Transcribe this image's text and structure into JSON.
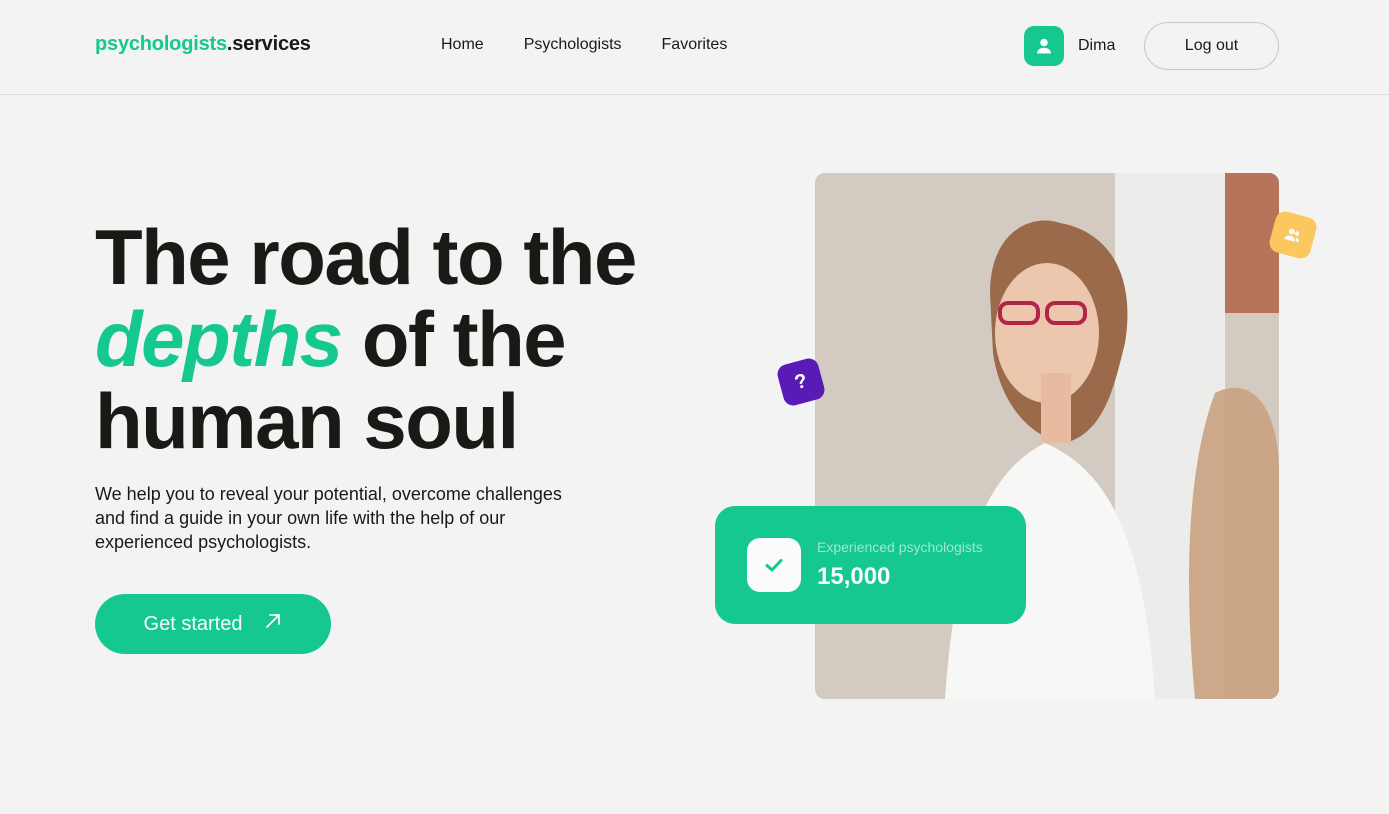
{
  "header": {
    "logo_accent": "psychologists",
    "logo_rest": ".services",
    "nav": [
      "Home",
      "Psychologists",
      "Favorites"
    ],
    "user_name": "Dima",
    "logout_label": "Log out"
  },
  "hero": {
    "title_line1": "The road to the",
    "title_accent": "depths",
    "title_line2_rest": " of the",
    "title_line3": "human soul",
    "description": "We help you to reveal your potential, overcome challenges and find a guide in your own life with the help of our experienced psychologists.",
    "cta_label": "Get started"
  },
  "stat": {
    "label": "Experienced psychologists",
    "value": "15,000"
  },
  "badges": {
    "question_symbol": "?"
  },
  "icons": {
    "user": "user-icon",
    "arrow": "arrow-up-right-icon",
    "check": "check-icon",
    "users": "users-icon",
    "question": "question-icon"
  },
  "colors": {
    "accent": "#14c88f",
    "purple": "#5a1ab5",
    "yellow": "#fbc75e",
    "background": "#f3f3f3",
    "text": "#191a15"
  }
}
